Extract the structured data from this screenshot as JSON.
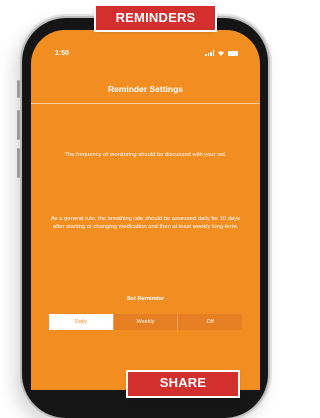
{
  "banner_top": "REMINDERS",
  "banner_bottom": "SHARE",
  "status_bar": {
    "time": "1:50"
  },
  "nav": {
    "title": "Reminder Settings"
  },
  "content": {
    "paragraph_1": "The frequency of monitoring should be discussed with your vet.",
    "paragraph_2": "As a general rule, the breathing rate should be assessed daily for 10 days after starting or changing medication and then at least weekly long-term."
  },
  "reminder": {
    "label": "Set Reminder",
    "options": [
      "Daily",
      "Weekly",
      "Off"
    ],
    "selected": "Daily"
  },
  "colors": {
    "screen_bg": "#f28e21",
    "banner": "#d32f2f"
  }
}
